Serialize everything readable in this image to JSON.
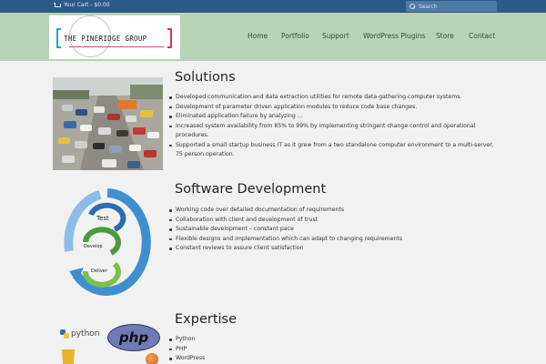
{
  "topbar": {
    "cart_text": "Your Cart - $0.00",
    "search_placeholder": "Search"
  },
  "header": {
    "logo_text": "THE PINERIDGE GROUP",
    "nav": [
      "Home",
      "Portfolio",
      "Support",
      "WordPress Plugins",
      "Store",
      "Contact"
    ]
  },
  "solutions": {
    "title": "Solutions",
    "items": [
      "Developed communication and data extraction utilities for remote data gathering computer systems.",
      "Development of parameter driven application modules to reduce code base changes.",
      "Eliminated application failure by analyzing …",
      "Increased system availability from 85% to 99% by implementing stringent change control and operational procedures.",
      "Supported a small startup business IT as it grew from a two standalone computer environment to a multi-server, 75 person operation."
    ]
  },
  "software": {
    "title": "Software Development",
    "items": [
      "Working code over detailed documentation of requirements",
      "Collaboration with client and development of trust",
      "Sustainable development – constant pace",
      "Flexible designs and implementation which can adapt to changing requirements",
      "Constant reviews to assure client satisfaction"
    ],
    "cycle_labels": [
      "Test",
      "Develop",
      "Deliver"
    ]
  },
  "expertise": {
    "title": "Expertise",
    "items": [
      "Python",
      "PHP",
      "WordPress"
    ],
    "logo_python": "python",
    "logo_php": "php"
  }
}
